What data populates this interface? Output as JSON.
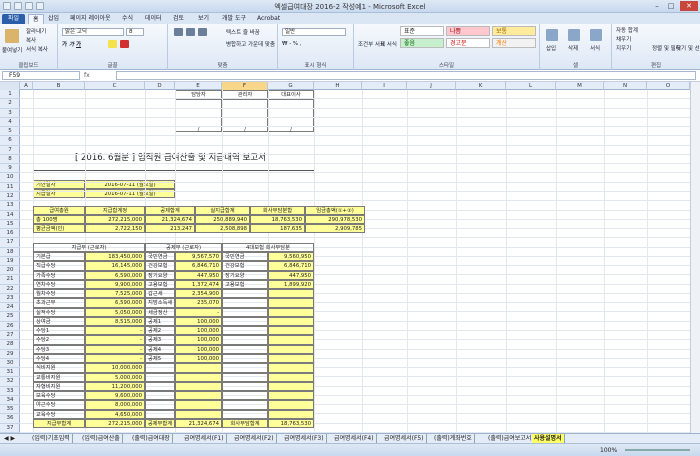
{
  "window": {
    "title": "엑셀급여대장 2016-2 작성예1 - Microsoft Excel"
  },
  "tabs": [
    {
      "label": "파일"
    },
    {
      "label": "홈"
    },
    {
      "label": "삽입"
    },
    {
      "label": "페이지 레이아웃"
    },
    {
      "label": "수식"
    },
    {
      "label": "데이터"
    },
    {
      "label": "검토"
    },
    {
      "label": "보기"
    },
    {
      "label": "개발 도구"
    },
    {
      "label": "Acrobat"
    }
  ],
  "ribbon": {
    "clipboard": {
      "label": "클립보드",
      "paste": "붙여넣기",
      "cut": "잘라내기",
      "copy": "복사",
      "format_painter": "서식 복사"
    },
    "font": {
      "label": "글꼴",
      "font_name": "맑은 고딕",
      "font_size": "8"
    },
    "align": {
      "label": "맞춤",
      "wrap": "텍스트 줄 바꿈",
      "merge": "병합하고 가운데 맞춤"
    },
    "number": {
      "label": "표시 형식",
      "format": "일반"
    },
    "styles": {
      "label": "스타일",
      "cond": "조건부 서식",
      "table": "표 서식",
      "normal": "표준",
      "bad": "나쁨",
      "good_neutral": "보통",
      "good": "좋음",
      "warn": "경고문",
      "calc": "계산"
    },
    "cells": {
      "label": "셀",
      "insert": "삽입",
      "delete": "삭제",
      "format": "서식"
    },
    "editing": {
      "label": "편집",
      "autosum": "자동 합계",
      "fill": "채우기",
      "clear": "지우기",
      "sort": "정렬 및 필터",
      "find": "찾기 및 선택"
    }
  },
  "formula": {
    "cell_ref": "F59",
    "fx": "fx",
    "content": ""
  },
  "columns": [
    "A",
    "B",
    "C",
    "D",
    "E",
    "F",
    "G",
    "H",
    "I",
    "J",
    "K",
    "L",
    "M",
    "N",
    "O"
  ],
  "rows": [
    "1",
    "2",
    "3",
    "4",
    "5",
    "6",
    "7",
    "8",
    "9",
    "10",
    "11",
    "12",
    "13",
    "14",
    "15",
    "16",
    "17",
    "18",
    "19",
    "20",
    "21",
    "22",
    "23",
    "24",
    "25",
    "26",
    "27",
    "28",
    "29",
    "30",
    "31",
    "32",
    "33",
    "34",
    "35",
    "36",
    "37"
  ],
  "approval": {
    "h1": "담당자",
    "h2": "관리자",
    "h3": "대표이사",
    "s1": "/",
    "s2": "/",
    "s3": "/"
  },
  "report": {
    "title": "[ 2016. 6월분 ] 임직원 급여산출 및 지급내역 보고서"
  },
  "dates": {
    "l1": "기안일자",
    "v1": "2016-07-11 (월요일)",
    "l2": "지급일자",
    "v2": "2016-07-11 (월요일)"
  },
  "summary": {
    "headers": [
      "급여총원",
      "지급합계정",
      "공제합계",
      "실지급합계",
      "회사부담분합",
      "임금총액(①+②)"
    ],
    "r1": [
      "총 100명",
      "272,215,000",
      "21,324,674",
      "250,889,940",
      "18,763,530",
      "290,978,530"
    ],
    "r2": [
      "평균금액(인)",
      "2,722,150",
      "213,247",
      "2,508,898",
      "187,635",
      "2,909,785"
    ]
  },
  "detail": {
    "h_pay": "지급부 (근로자)",
    "h_ded": "공제부 (근로자)",
    "h_co": "4대보험 회사부담분",
    "pay": [
      [
        "기본급",
        "183,450,000"
      ],
      [
        "직급수당",
        "16,145,000"
      ],
      [
        "가족수당",
        "6,590,000"
      ],
      [
        "연차수당",
        "9,900,000"
      ],
      [
        "월차수당",
        "7,525,000"
      ],
      [
        "초과근무",
        "6,590,000"
      ],
      [
        "실적수당",
        "5,050,000"
      ],
      [
        "상여금",
        "8,515,000"
      ],
      [
        "수당1",
        "-"
      ],
      [
        "수당2",
        "-"
      ],
      [
        "수당3",
        "-"
      ],
      [
        "수당4",
        "-"
      ],
      [
        "식비지원",
        "10,000,000"
      ],
      [
        "교통비지원",
        "5,000,000"
      ],
      [
        "자형비지원",
        "11,200,000"
      ],
      [
        "보육수당",
        "9,600,000"
      ],
      [
        "야근수당",
        "8,000,000"
      ],
      [
        "교육수당",
        "4,650,000"
      ]
    ],
    "ded": [
      [
        "국민연금",
        "9,567,570"
      ],
      [
        "건강보험",
        "6,846,710"
      ],
      [
        "장기요양",
        "447,950"
      ],
      [
        "고용보험",
        "1,372,474"
      ],
      [
        "갑근세",
        "2,354,900"
      ],
      [
        "지방소득세",
        "235,070"
      ],
      [
        "세금정산",
        "-"
      ],
      [
        "공제1",
        "100,000"
      ],
      [
        "공제2",
        "100,000"
      ],
      [
        "공제3",
        "100,000"
      ],
      [
        "공제4",
        "100,000"
      ],
      [
        "공제5",
        "100,000"
      ]
    ],
    "co": [
      [
        "국민연금",
        "9,560,950"
      ],
      [
        "건강보험",
        "6,846,710"
      ],
      [
        "장기요양",
        "447,950"
      ],
      [
        "고용보험",
        "1,899,920"
      ]
    ],
    "totals": {
      "pay_l": "지급부합계",
      "pay_v": "272,215,000",
      "ded_l": "공제부합계",
      "ded_v": "21,324,674",
      "co_l": "회사부담합계",
      "co_v": "18,763,530"
    }
  },
  "sheet_tabs": [
    "(입력)기초입력",
    "(입력)급여산출",
    "(출력)급여대장",
    "급여명세서(F1)",
    "급여명세서(F2)",
    "급여명세서(F3)",
    "급여명세서(F4)",
    "급여명세서(F5)",
    "(출력)계좌번호",
    "(출력)급여보고서",
    "사용설명서"
  ],
  "status": {
    "zoom": "100%"
  }
}
